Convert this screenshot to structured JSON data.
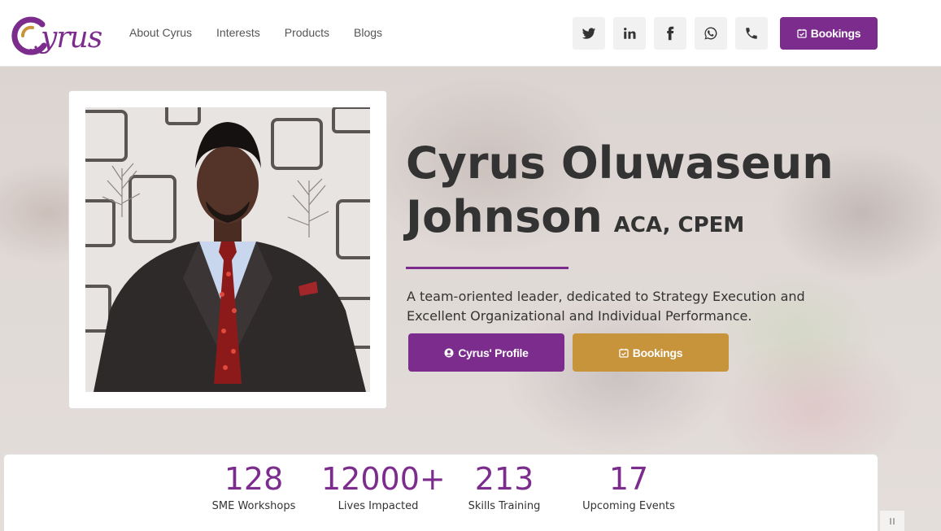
{
  "header": {
    "logo_text": "yrus",
    "nav": [
      "About Cyrus",
      "Interests",
      "Products",
      "Blogs"
    ],
    "socials": [
      "twitter-icon",
      "linkedin-icon",
      "facebook-icon",
      "whatsapp-icon",
      "phone-icon"
    ],
    "bookings_label": "Bookings"
  },
  "hero": {
    "name_line1": "Cyrus Oluwaseun",
    "name_line2": "Johnson",
    "credentials": "ACA, CPEM",
    "tagline": "A team-oriented leader, dedicated to Strategy Execution and Excellent Organizational and Individual Performance.",
    "profile_button": "Cyrus' Profile",
    "bookings_button": "Bookings"
  },
  "stats": [
    {
      "value": "128",
      "label": "SME Workshops"
    },
    {
      "value": "12000+",
      "label": "Lives Impacted"
    },
    {
      "value": "213",
      "label": "Skills Training"
    },
    {
      "value": "17",
      "label": "Upcoming Events"
    }
  ],
  "colors": {
    "accent": "#7b2c8c",
    "gold": "#c8943b"
  }
}
